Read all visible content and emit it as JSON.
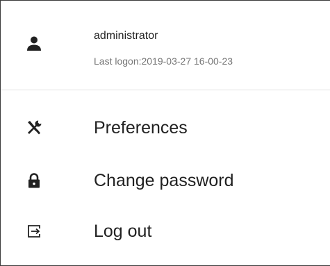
{
  "user": {
    "icon": "person-icon",
    "name": "administrator",
    "last_logon": "Last logon:2019-03-27 16-00-23"
  },
  "menu": {
    "items": [
      {
        "icon": "tools-icon",
        "label": "Preferences"
      },
      {
        "icon": "lock-icon",
        "label": "Change password"
      },
      {
        "icon": "logout-icon",
        "label": "Log out"
      }
    ]
  },
  "colors": {
    "text_primary": "#212121",
    "text_secondary": "#757575",
    "divider": "#e3e3e3",
    "border": "#3a3a3a"
  }
}
